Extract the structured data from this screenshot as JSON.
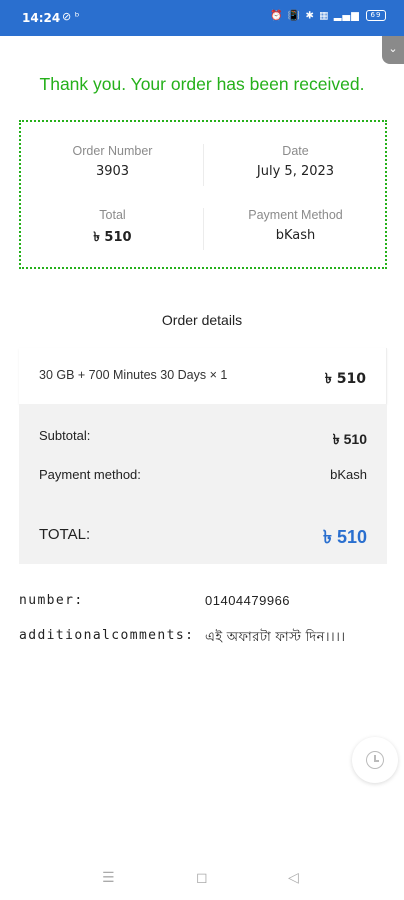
{
  "status_bar": {
    "time": "14:24",
    "left_icons": "⊘ ᵇ",
    "right_icons": "⏰ 📳 ✱ ▦ ▂▄▆",
    "battery": "69"
  },
  "thank_you_message": "Thank you. Your order has been received.",
  "order_summary": {
    "order_number_label": "Order Number",
    "order_number": "3903",
    "date_label": "Date",
    "date": "July 5, 2023",
    "total_label": "Total",
    "total": "৳ 510",
    "payment_method_label": "Payment Method",
    "payment_method": "bKash"
  },
  "order_details": {
    "title": "Order details",
    "item_name": "30 GB + 700 Minutes 30 Days × 1",
    "item_price": "৳ 510",
    "subtotal_label": "Subtotal:",
    "subtotal": "৳ 510",
    "payment_method_label": "Payment method:",
    "payment_method": "bKash",
    "total_label": "TOTAL:",
    "total": "৳ 510"
  },
  "custom_fields": {
    "number_label": "number:",
    "number": "01404479966",
    "comments_label": "additionalcomments:",
    "comments": "এই অফারটা ফাস্ট দিন।।।।"
  },
  "nav_bar": {
    "menu": "☰",
    "home": "◻",
    "back": "◁"
  }
}
